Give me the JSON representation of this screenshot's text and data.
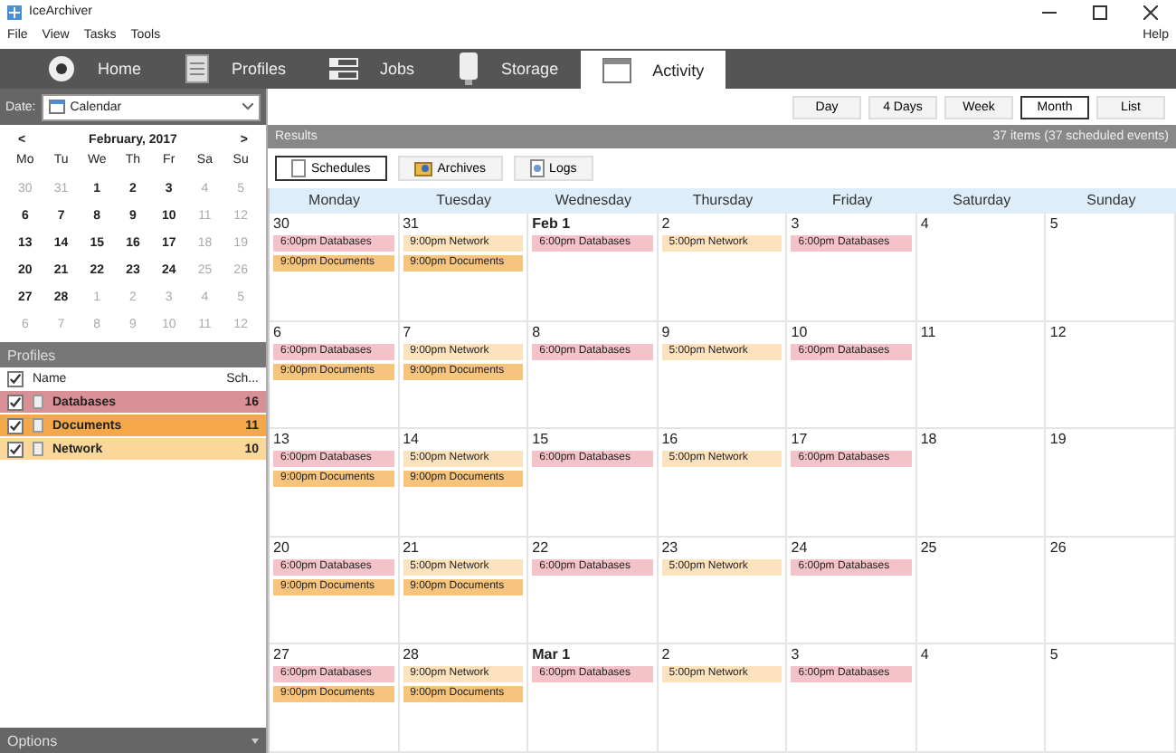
{
  "window": {
    "title": "IceArchiver"
  },
  "menu": [
    "File",
    "View",
    "Tasks",
    "Tools"
  ],
  "help": "Help",
  "tabs": [
    {
      "label": "Home",
      "selected": false,
      "kind": "home"
    },
    {
      "label": "Profiles",
      "selected": false,
      "kind": "profiles"
    },
    {
      "label": "Jobs",
      "selected": false,
      "kind": "jobs"
    },
    {
      "label": "Storage",
      "selected": false,
      "kind": "storage"
    },
    {
      "label": "Activity",
      "selected": true,
      "kind": "activity"
    }
  ],
  "date_filter": {
    "label": "Date:",
    "value": "Calendar"
  },
  "mini_calendar": {
    "month": "February, 2017",
    "prev": "<",
    "next": ">",
    "weekdays": [
      "Mo",
      "Tu",
      "We",
      "Th",
      "Fr",
      "Sa",
      "Su"
    ],
    "weeks": [
      [
        {
          "day": "30",
          "muted": true
        },
        {
          "day": "31",
          "muted": true
        },
        {
          "day": "1",
          "muted": false
        },
        {
          "day": "2",
          "muted": false
        },
        {
          "day": "3",
          "muted": false
        },
        {
          "day": "4",
          "muted": true
        },
        {
          "day": "5",
          "muted": true
        }
      ],
      [
        {
          "day": "6",
          "muted": false
        },
        {
          "day": "7",
          "muted": false
        },
        {
          "day": "8",
          "muted": false
        },
        {
          "day": "9",
          "muted": false
        },
        {
          "day": "10",
          "muted": false
        },
        {
          "day": "11",
          "muted": true
        },
        {
          "day": "12",
          "muted": true
        }
      ],
      [
        {
          "day": "13",
          "muted": false
        },
        {
          "day": "14",
          "muted": false
        },
        {
          "day": "15",
          "muted": false
        },
        {
          "day": "16",
          "muted": false
        },
        {
          "day": "17",
          "muted": false
        },
        {
          "day": "18",
          "muted": true
        },
        {
          "day": "19",
          "muted": true
        }
      ],
      [
        {
          "day": "20",
          "muted": false
        },
        {
          "day": "21",
          "muted": false
        },
        {
          "day": "22",
          "muted": false
        },
        {
          "day": "23",
          "muted": false
        },
        {
          "day": "24",
          "muted": false
        },
        {
          "day": "25",
          "muted": true
        },
        {
          "day": "26",
          "muted": true
        }
      ],
      [
        {
          "day": "27",
          "muted": false
        },
        {
          "day": "28",
          "muted": false
        },
        {
          "day": "1",
          "muted": true
        },
        {
          "day": "2",
          "muted": true
        },
        {
          "day": "3",
          "muted": true
        },
        {
          "day": "4",
          "muted": true
        },
        {
          "day": "5",
          "muted": true
        }
      ],
      [
        {
          "day": "6",
          "muted": true
        },
        {
          "day": "7",
          "muted": true
        },
        {
          "day": "8",
          "muted": true
        },
        {
          "day": "9",
          "muted": true
        },
        {
          "day": "10",
          "muted": true
        },
        {
          "day": "11",
          "muted": true
        },
        {
          "day": "12",
          "muted": true
        }
      ]
    ]
  },
  "profiles": {
    "title": "Profiles",
    "header_checked": true,
    "columns": [
      "Name",
      "Sch..."
    ],
    "rows": [
      {
        "name": "Databases",
        "count": "16",
        "checked": true,
        "color": "#d98f96"
      },
      {
        "name": "Documents",
        "count": "11",
        "checked": true,
        "color": "#f5a84a"
      },
      {
        "name": "Network",
        "count": "10",
        "checked": true,
        "color": "#fcd79a"
      }
    ]
  },
  "options": {
    "label": "Options"
  },
  "views": [
    {
      "label": "Day",
      "selected": false
    },
    {
      "label": "4 Days",
      "selected": false
    },
    {
      "label": "Week",
      "selected": false
    },
    {
      "label": "Month",
      "selected": true
    },
    {
      "label": "List",
      "selected": false
    }
  ],
  "results": {
    "title": "Results",
    "summary": "37 items (37 scheduled events)"
  },
  "subtabs": [
    {
      "label": "Schedules",
      "selected": true,
      "kind": "schedules"
    },
    {
      "label": "Archives",
      "selected": false,
      "kind": "archives"
    },
    {
      "label": "Logs",
      "selected": false,
      "kind": "logs"
    }
  ],
  "calendar": {
    "weekdays": [
      "Monday",
      "Tuesday",
      "Wednesday",
      "Thursday",
      "Friday",
      "Saturday",
      "Sunday"
    ],
    "weeks": [
      [
        {
          "date": "30",
          "month_start": false,
          "events": [
            {
              "text": "6:00pm Databases",
              "color": "#f4c3c9"
            },
            {
              "text": "9:00pm Documents",
              "color": "#f7c47e"
            }
          ]
        },
        {
          "date": "31",
          "month_start": false,
          "events": [
            {
              "text": "9:00pm Network",
              "color": "#fde3bd"
            },
            {
              "text": "9:00pm Documents",
              "color": "#f7c47e"
            }
          ]
        },
        {
          "date": "Feb 1",
          "month_start": true,
          "events": [
            {
              "text": "6:00pm Databases",
              "color": "#f4c3c9"
            }
          ]
        },
        {
          "date": "2",
          "month_start": false,
          "events": [
            {
              "text": "5:00pm Network",
              "color": "#fde3bd"
            }
          ]
        },
        {
          "date": "3",
          "month_start": false,
          "events": [
            {
              "text": "6:00pm Databases",
              "color": "#f4c3c9"
            }
          ]
        },
        {
          "date": "4",
          "month_start": false
        },
        {
          "date": "5",
          "month_start": false
        }
      ],
      [
        {
          "date": "6",
          "month_start": false,
          "events": [
            {
              "text": "6:00pm Databases",
              "color": "#f4c3c9"
            },
            {
              "text": "9:00pm Documents",
              "color": "#f7c47e"
            }
          ]
        },
        {
          "date": "7",
          "month_start": false,
          "events": [
            {
              "text": "9:00pm Network",
              "color": "#fde3bd"
            },
            {
              "text": "9:00pm Documents",
              "color": "#f7c47e"
            }
          ]
        },
        {
          "date": "8",
          "month_start": false,
          "events": [
            {
              "text": "6:00pm Databases",
              "color": "#f4c3c9"
            }
          ]
        },
        {
          "date": "9",
          "month_start": false,
          "events": [
            {
              "text": "5:00pm Network",
              "color": "#fde3bd"
            }
          ]
        },
        {
          "date": "10",
          "month_start": false,
          "events": [
            {
              "text": "6:00pm Databases",
              "color": "#f4c3c9"
            }
          ]
        },
        {
          "date": "11",
          "month_start": false
        },
        {
          "date": "12",
          "month_start": false
        }
      ],
      [
        {
          "date": "13",
          "month_start": false,
          "events": [
            {
              "text": "6:00pm Databases",
              "color": "#f4c3c9"
            },
            {
              "text": "9:00pm Documents",
              "color": "#f7c47e"
            }
          ]
        },
        {
          "date": "14",
          "month_start": false,
          "events": [
            {
              "text": "5:00pm Network",
              "color": "#fde3bd"
            },
            {
              "text": "9:00pm Documents",
              "color": "#f7c47e"
            }
          ]
        },
        {
          "date": "15",
          "month_start": false,
          "events": [
            {
              "text": "6:00pm Databases",
              "color": "#f4c3c9"
            }
          ]
        },
        {
          "date": "16",
          "month_start": false,
          "events": [
            {
              "text": "5:00pm Network",
              "color": "#fde3bd"
            }
          ]
        },
        {
          "date": "17",
          "month_start": false,
          "events": [
            {
              "text": "6:00pm Databases",
              "color": "#f4c3c9"
            }
          ]
        },
        {
          "date": "18",
          "month_start": false
        },
        {
          "date": "19",
          "month_start": false
        }
      ],
      [
        {
          "date": "20",
          "month_start": false,
          "events": [
            {
              "text": "6:00pm Databases",
              "color": "#f4c3c9"
            },
            {
              "text": "9:00pm Documents",
              "color": "#f7c47e"
            }
          ]
        },
        {
          "date": "21",
          "month_start": false,
          "events": [
            {
              "text": "5:00pm Network",
              "color": "#fde3bd"
            },
            {
              "text": "9:00pm Documents",
              "color": "#f7c47e"
            }
          ]
        },
        {
          "date": "22",
          "month_start": false,
          "events": [
            {
              "text": "6:00pm Databases",
              "color": "#f4c3c9"
            }
          ]
        },
        {
          "date": "23",
          "month_start": false,
          "events": [
            {
              "text": "5:00pm Network",
              "color": "#fde3bd"
            }
          ]
        },
        {
          "date": "24",
          "month_start": false,
          "events": [
            {
              "text": "6:00pm Databases",
              "color": "#f4c3c9"
            }
          ]
        },
        {
          "date": "25",
          "month_start": false
        },
        {
          "date": "26",
          "month_start": false
        }
      ],
      [
        {
          "date": "27",
          "month_start": false,
          "events": [
            {
              "text": "6:00pm Databases",
              "color": "#f4c3c9"
            },
            {
              "text": "9:00pm Documents",
              "color": "#f7c47e"
            }
          ]
        },
        {
          "date": "28",
          "month_start": false,
          "events": [
            {
              "text": "9:00pm Network",
              "color": "#fde3bd"
            },
            {
              "text": "9:00pm Documents",
              "color": "#f7c47e"
            }
          ]
        },
        {
          "date": "Mar 1",
          "month_start": true,
          "events": [
            {
              "text": "6:00pm Databases",
              "color": "#f4c3c9"
            }
          ]
        },
        {
          "date": "2",
          "month_start": false,
          "events": [
            {
              "text": "5:00pm Network",
              "color": "#fde3bd"
            }
          ]
        },
        {
          "date": "3",
          "month_start": false,
          "events": [
            {
              "text": "6:00pm Databases",
              "color": "#f4c3c9"
            }
          ]
        },
        {
          "date": "4",
          "month_start": false
        },
        {
          "date": "5",
          "month_start": false
        }
      ]
    ]
  }
}
